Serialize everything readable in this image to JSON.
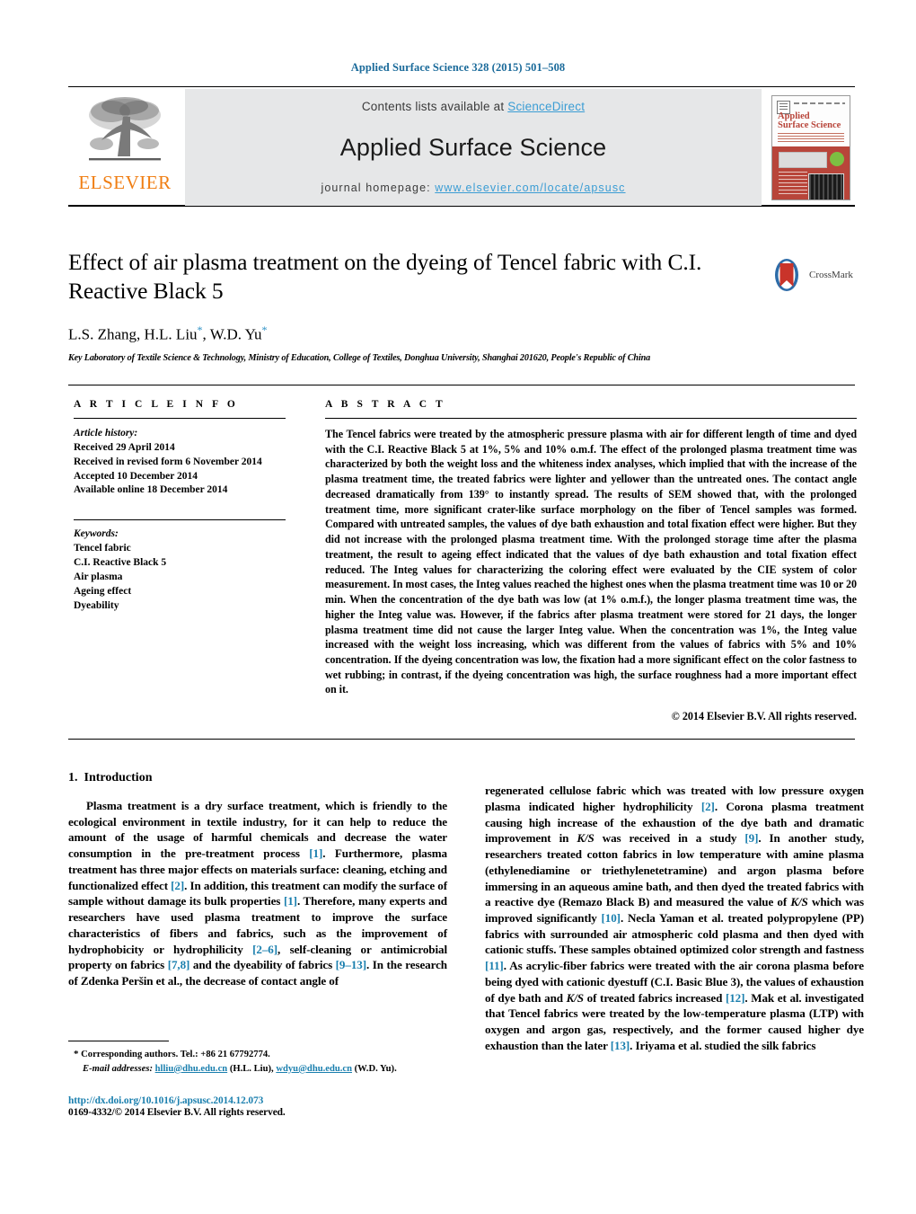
{
  "running_head": "Applied Surface Science 328 (2015) 501–508",
  "masthead": {
    "publisher_logo_text": "ELSEVIER",
    "contents_prefix": "Contents lists available at ",
    "contents_link": "ScienceDirect",
    "journal_title": "Applied Surface Science",
    "homepage_prefix": "journal homepage: ",
    "homepage_url": "www.elsevier.com/locate/apsusc",
    "cover": {
      "line1": "Applied",
      "line2": "Surface Science"
    }
  },
  "article": {
    "title": "Effect of air plasma treatment on the dyeing of Tencel fabric with C.I. Reactive Black 5",
    "crossmark_label": "CrossMark",
    "authors": "L.S. Zhang, H.L. Liu",
    "authors_part2": ", W.D. Yu",
    "star": "*",
    "affiliation": "Key Laboratory of Textile Science & Technology, Ministry of Education, College of Textiles, Donghua University, Shanghai 201620, People's Republic of China"
  },
  "info": {
    "heading": "A R T I C L E  I N F O",
    "history_label": "Article history:",
    "history": [
      "Received 29 April 2014",
      "Received in revised form 6 November 2014",
      "Accepted 10 December 2014",
      "Available online 18 December 2014"
    ],
    "keywords_label": "Keywords:",
    "keywords": [
      "Tencel fabric",
      "C.I. Reactive Black 5",
      "Air plasma",
      "Ageing effect",
      "Dyeability"
    ]
  },
  "abstract": {
    "heading": "A B S T R A C T",
    "text": "The Tencel fabrics were treated by the atmospheric pressure plasma with air for different length of time and dyed with the C.I. Reactive Black 5 at 1%, 5% and 10% o.m.f. The effect of the prolonged plasma treatment time was characterized by both the weight loss and the whiteness index analyses, which implied that with the increase of the plasma treatment time, the treated fabrics were lighter and yellower than the untreated ones. The contact angle decreased dramatically from 139° to instantly spread. The results of SEM showed that, with the prolonged treatment time, more significant crater-like surface morphology on the fiber of Tencel samples was formed. Compared with untreated samples, the values of dye bath exhaustion and total fixation effect were higher. But they did not increase with the prolonged plasma treatment time. With the prolonged storage time after the plasma treatment, the result to ageing effect indicated that the values of dye bath exhaustion and total fixation effect reduced. The Integ values for characterizing the coloring effect were evaluated by the CIE system of color measurement. In most cases, the Integ values reached the highest ones when the plasma treatment time was 10 or 20 min. When the concentration of the dye bath was low (at 1% o.m.f.), the longer plasma treatment time was, the higher the Integ value was. However, if the fabrics after plasma treatment were stored for 21 days, the longer plasma treatment time did not cause the larger Integ value. When the concentration was 1%, the Integ value increased with the weight loss increasing, which was different from the values of fabrics with 5% and 10% concentration. If the dyeing concentration was low, the fixation had a more significant effect on the color fastness to wet rubbing; in contrast, if the dyeing concentration was high, the surface roughness had a more important effect on it.",
    "copyright": "© 2014 Elsevier B.V. All rights reserved."
  },
  "introduction": {
    "number": "1.",
    "heading": "Introduction",
    "left_paragraph_html": "Plasma treatment is a dry surface treatment, which is friendly to the ecological environment in textile industry, for it can help to reduce the amount of the usage of harmful chemicals and decrease the water consumption in the pre-treatment process <span class=\"ref\">[1]</span>. Furthermore, plasma treatment has three major effects on materials surface: cleaning, etching and functionalized effect <span class=\"ref\">[2]</span>. In addition, this treatment can modify the surface of sample without damage its bulk properties <span class=\"ref\">[1]</span>. Therefore, many experts and researchers have used plasma treatment to improve the surface characteristics of fibers and fabrics, such as the improvement of hydrophobicity or hydrophilicity <span class=\"ref\">[2–6]</span>, self-cleaning or antimicrobial property on fabrics <span class=\"ref\">[7,8]</span> and the dyeability of fabrics <span class=\"ref\">[9–13]</span>. In the research of Zdenka Peršin et al., the decrease of contact angle of",
    "right_paragraph_html": "regenerated cellulose fabric which was treated with low pressure oxygen plasma indicated higher hydrophilicity <span class=\"ref\">[2]</span>. Corona plasma treatment causing high increase of the exhaustion of the dye bath and dramatic improvement in <em>K/S</em> was received in a study <span class=\"ref\">[9]</span>. In another study, researchers treated cotton fabrics in low temperature with amine plasma (ethylenediamine or triethylenetetramine) and argon plasma before immersing in an aqueous amine bath, and then dyed the treated fabrics with a reactive dye (Remazo Black B) and measured the value of <em>K/S</em> which was improved significantly <span class=\"ref\">[10]</span>. Necla Yaman et al. treated polypropylene (PP) fabrics with surrounded air atmospheric cold plasma and then dyed with cationic stuffs. These samples obtained optimized color strength and fastness <span class=\"ref\">[11]</span>. As acrylic-fiber fabrics were treated with the air corona plasma before being dyed with cationic dyestuff (C.I. Basic Blue 3), the values of exhaustion of dye bath and <em>K/S</em> of treated fabrics increased <span class=\"ref\">[12]</span>. Mak et al. investigated that Tencel fabrics were treated by the low-temperature plasma (LTP) with oxygen and argon gas, respectively, and the former caused higher dye exhaustion than the later <span class=\"ref\">[13]</span>. Iriyama et al. studied the silk fabrics"
  },
  "footnote": {
    "star": "*",
    "corresponding": "Corresponding authors. Tel.: +86 21 67792774.",
    "email_label": "E-mail addresses:",
    "email1": "hlliu@dhu.edu.cn",
    "email1_owner": "(H.L. Liu),",
    "email2": "wdyu@dhu.edu.cn",
    "email2_owner": "(W.D. Yu)."
  },
  "doi": {
    "url": "http://dx.doi.org/10.1016/j.apsusc.2014.12.073",
    "issn_line": "0169-4332/© 2014 Elsevier B.V. All rights reserved."
  },
  "colors": {
    "link": "#1a7fae",
    "sciencedirect": "#3b9dd4",
    "elsevier_orange": "#f07e13",
    "crossmark_red": "#c9342a",
    "crossmark_blue": "#2d6ca8",
    "band_grey": "#e6e7e8"
  }
}
